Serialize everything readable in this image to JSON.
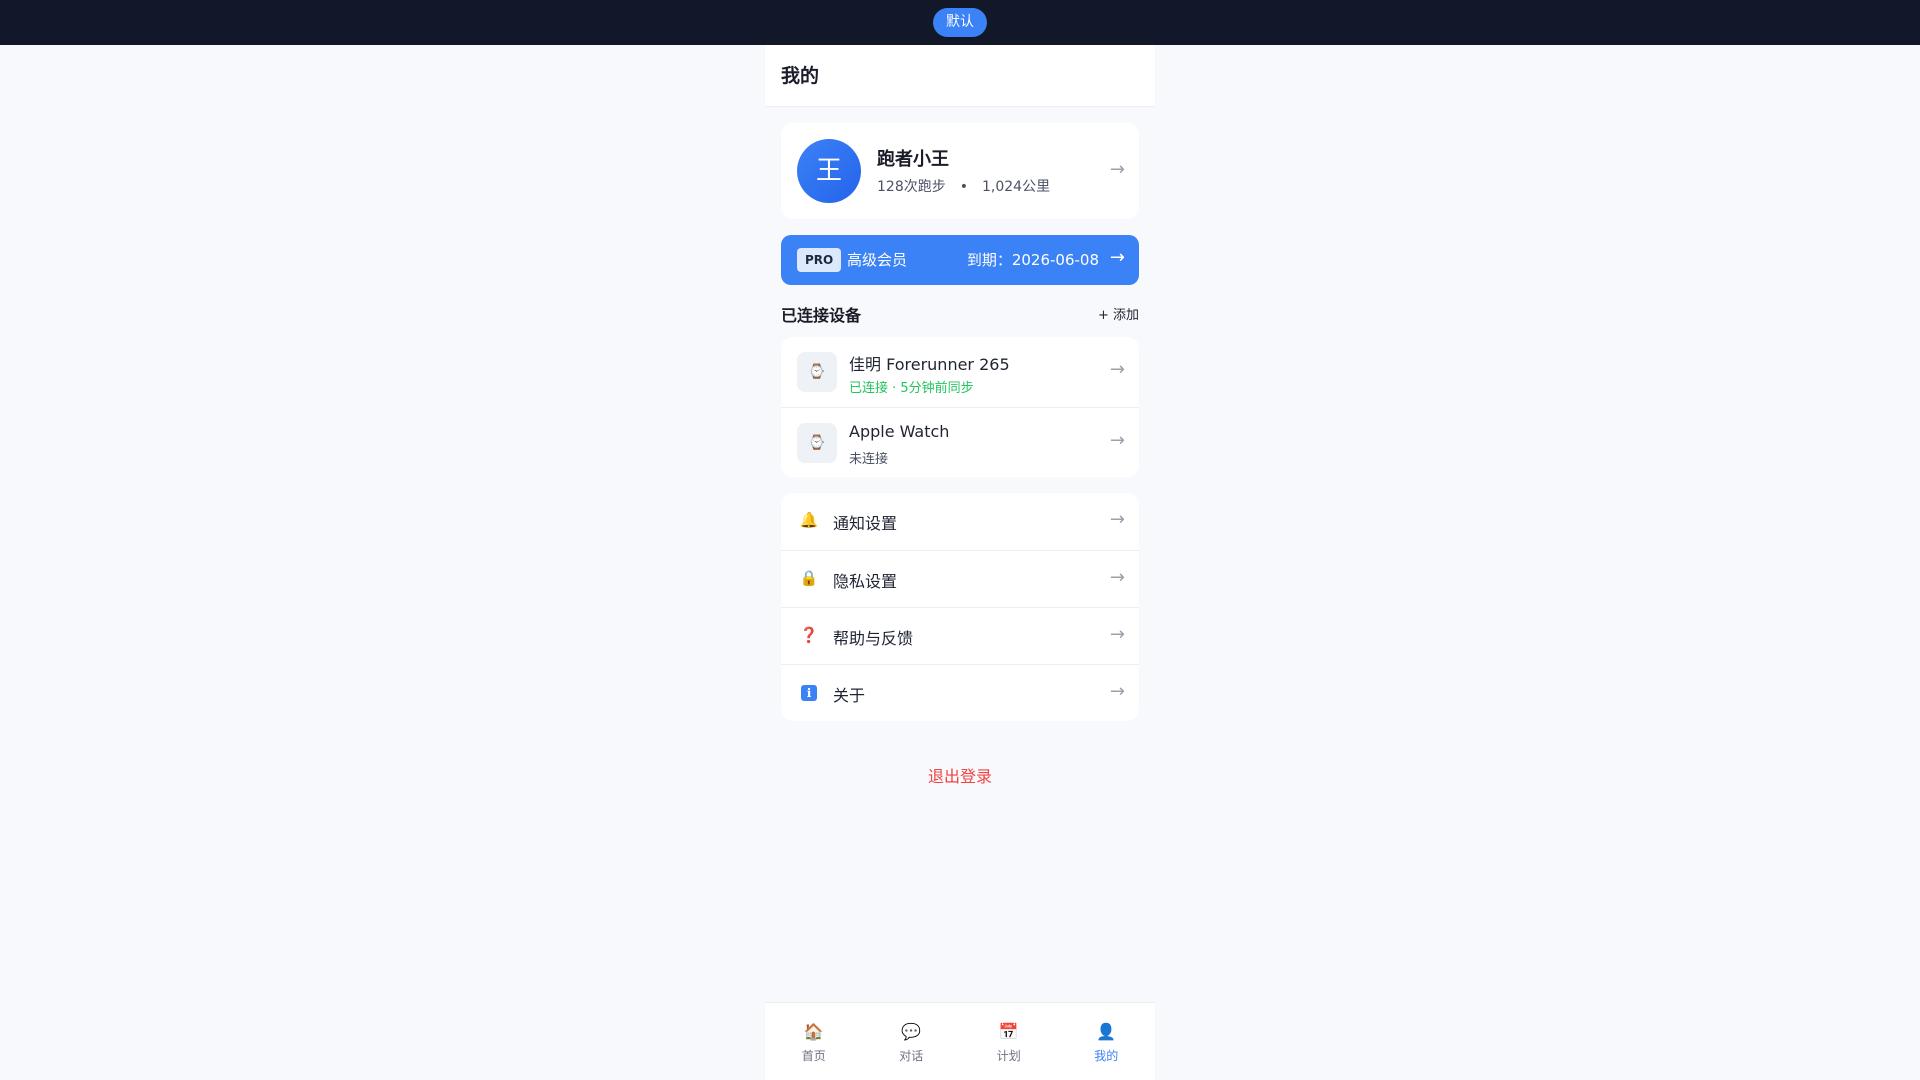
{
  "topbar": {
    "pill_label": "默认"
  },
  "header": {
    "title": "我的"
  },
  "profile": {
    "avatar_char": "王",
    "name": "跑者小王",
    "runs": "128次跑步",
    "separator": "•",
    "distance": "1,024公里"
  },
  "pro": {
    "tag": "PRO",
    "label": "高级会员",
    "expiry": "到期：2026-06-08"
  },
  "devices_section": {
    "title": "已连接设备",
    "add_label": "+ 添加"
  },
  "devices": [
    {
      "name": "佳明 Forerunner 265",
      "status": "已连接 · 5分钟前同步",
      "connected": true,
      "icon": "watch-icon"
    },
    {
      "name": "Apple Watch",
      "status": "未连接",
      "connected": false,
      "icon": "watch-icon"
    }
  ],
  "menu": [
    {
      "icon": "bell-icon",
      "glyph": "🔔",
      "label": "通知设置"
    },
    {
      "icon": "lock-icon",
      "glyph": "🔒",
      "label": "隐私设置"
    },
    {
      "icon": "question-icon",
      "glyph": "❓",
      "label": "帮助与反馈"
    },
    {
      "icon": "info-icon",
      "glyph": "ℹ",
      "label": "关于"
    }
  ],
  "logout_label": "退出登录",
  "arrow_glyph": "→",
  "tabs": [
    {
      "icon": "home-icon",
      "glyph": "🏠",
      "label": "首页",
      "active": false
    },
    {
      "icon": "chat-icon",
      "glyph": "💬",
      "label": "对话",
      "active": false
    },
    {
      "icon": "calendar-icon",
      "glyph": "📅",
      "label": "计划",
      "active": false
    },
    {
      "icon": "user-icon",
      "glyph": "👤",
      "label": "我的",
      "active": true
    }
  ],
  "colors": {
    "accent": "#3b82f6",
    "topbar": "#121829",
    "danger": "#ef4444",
    "success": "#22c55e"
  }
}
